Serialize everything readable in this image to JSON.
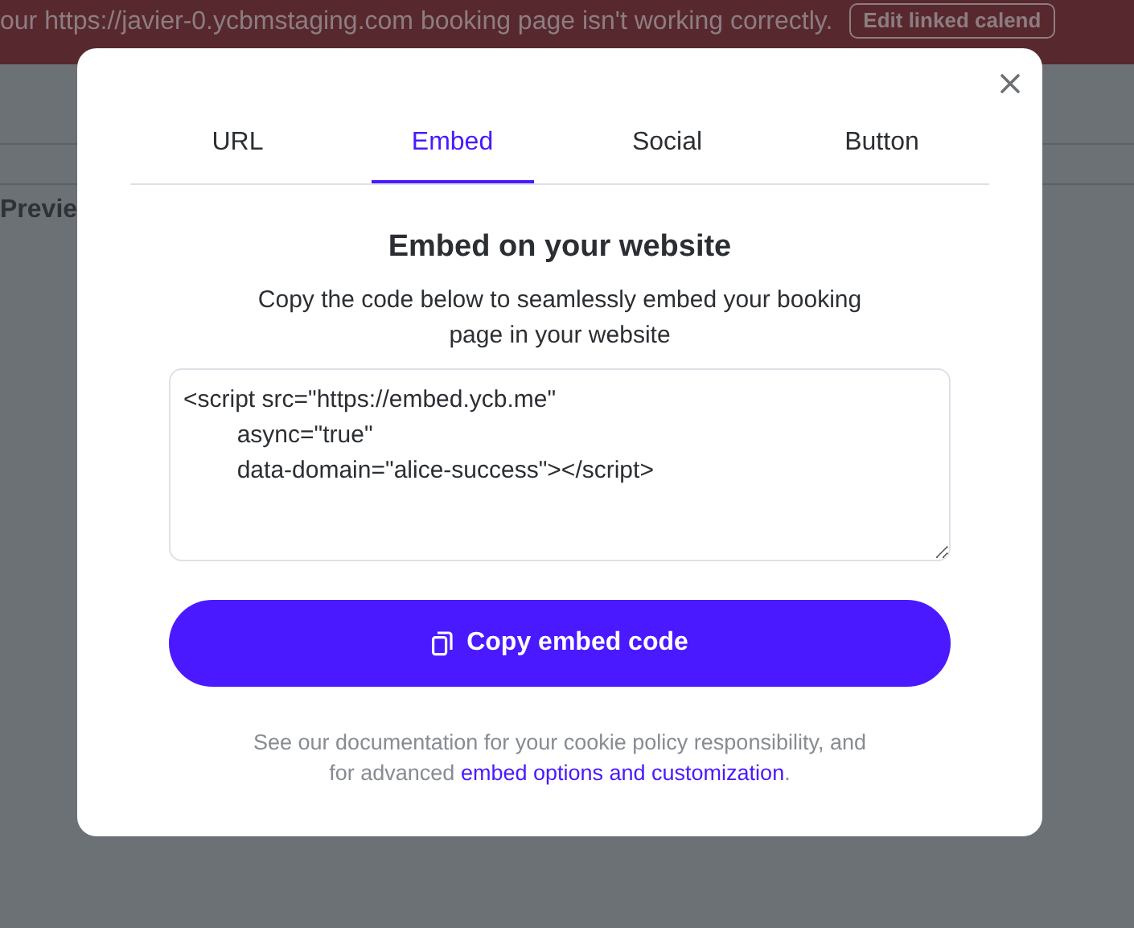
{
  "background": {
    "banner": {
      "message": "our https://javier-0.ycbmstaging.com booking page isn't working correctly.",
      "button": "Edit linked calend"
    },
    "section_label": "Previe"
  },
  "modal": {
    "tabs": [
      {
        "label": "URL",
        "selected": false
      },
      {
        "label": "Embed",
        "selected": true
      },
      {
        "label": "Social",
        "selected": false
      },
      {
        "label": "Button",
        "selected": false
      }
    ],
    "heading": "Embed on your website",
    "description": "Copy the code below to seamlessly embed your booking page in your website",
    "code": "<script src=\"https://embed.ycb.me\"\n\tasync=\"true\"\n\tdata-domain=\"alice-success\"></script>",
    "copy_button": "Copy embed code",
    "footer": {
      "text": "See our documentation for your cookie policy responsibility, and for advanced",
      "link": "embed options and customization",
      "end": "."
    }
  }
}
